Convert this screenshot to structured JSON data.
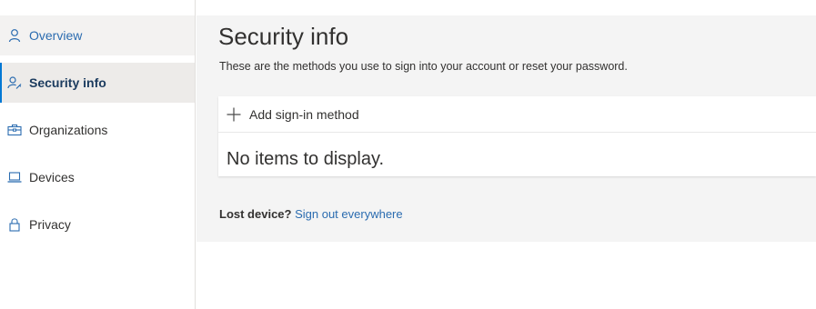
{
  "sidebar": {
    "items": [
      {
        "label": "Overview",
        "icon": "person-icon"
      },
      {
        "label": "Security info",
        "icon": "person-key-icon"
      },
      {
        "label": "Organizations",
        "icon": "briefcase-icon"
      },
      {
        "label": "Devices",
        "icon": "laptop-icon"
      },
      {
        "label": "Privacy",
        "icon": "lock-icon"
      }
    ],
    "active_index": 1
  },
  "main": {
    "title": "Security info",
    "subtitle": "These are the methods you use to sign into your account or reset your password.",
    "add_method_label": "Add sign-in method",
    "empty_message": "No items to display.",
    "lost_device_question": "Lost device?",
    "sign_out_link": "Sign out everywhere"
  },
  "colors": {
    "accent": "#0078d4",
    "link": "#2b6cb0",
    "panel_bg": "#f4f4f4"
  }
}
